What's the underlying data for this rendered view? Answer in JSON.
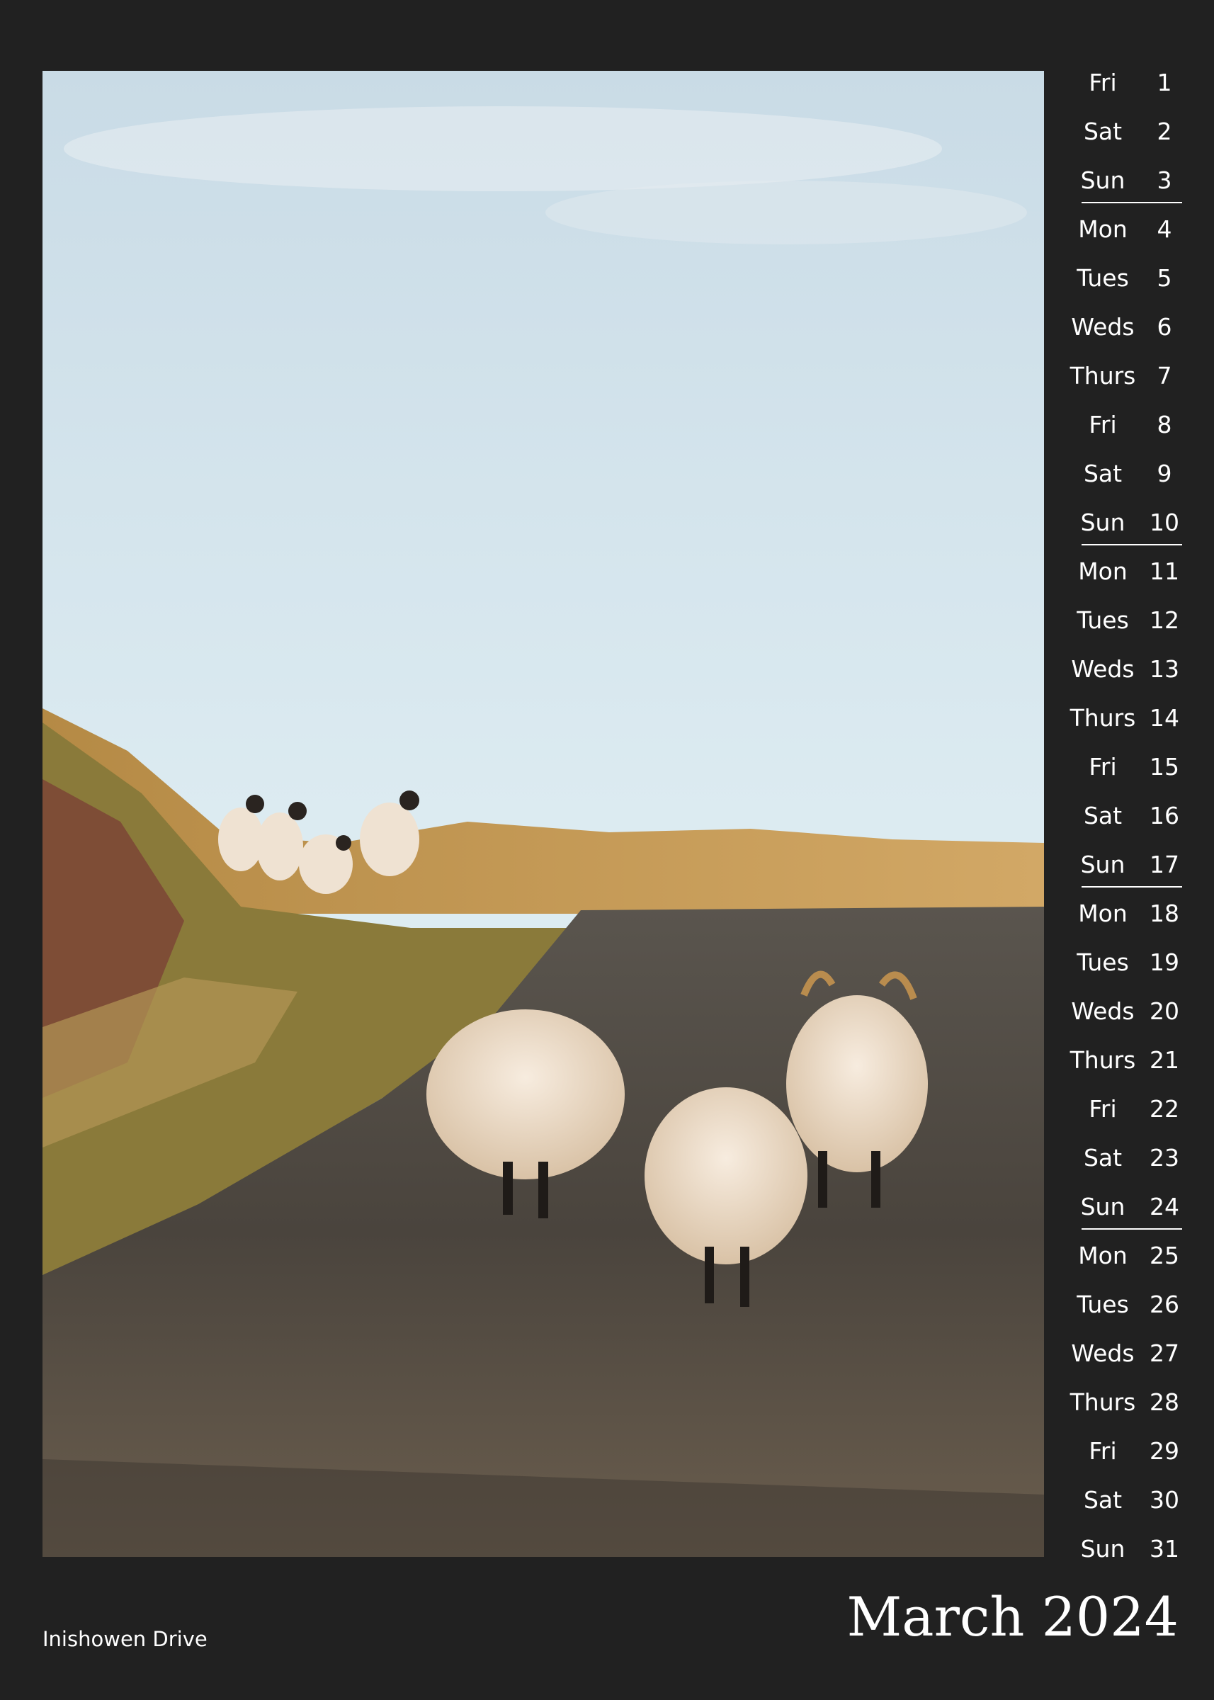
{
  "calendar": {
    "month_title": "March 2024",
    "location": "Inishowen Drive",
    "days": [
      {
        "name": "Fri",
        "number": "1"
      },
      {
        "name": "Sat",
        "number": "2"
      },
      {
        "name": "Sun",
        "number": "3"
      },
      {
        "name": "Mon",
        "number": "4"
      },
      {
        "name": "Tues",
        "number": "5"
      },
      {
        "name": "Weds",
        "number": "6"
      },
      {
        "name": "Thurs",
        "number": "7"
      },
      {
        "name": "Fri",
        "number": "8"
      },
      {
        "name": "Sat",
        "number": "9"
      },
      {
        "name": "Sun",
        "number": "10"
      },
      {
        "name": "Mon",
        "number": "11"
      },
      {
        "name": "Tues",
        "number": "12"
      },
      {
        "name": "Weds",
        "number": "13"
      },
      {
        "name": "Thurs",
        "number": "14"
      },
      {
        "name": "Fri",
        "number": "15"
      },
      {
        "name": "Sat",
        "number": "16"
      },
      {
        "name": "Sun",
        "number": "17"
      },
      {
        "name": "Mon",
        "number": "18"
      },
      {
        "name": "Tues",
        "number": "19"
      },
      {
        "name": "Weds",
        "number": "20"
      },
      {
        "name": "Thurs",
        "number": "21"
      },
      {
        "name": "Fri",
        "number": "22"
      },
      {
        "name": "Sat",
        "number": "23"
      },
      {
        "name": "Sun",
        "number": "24"
      },
      {
        "name": "Mon",
        "number": "25"
      },
      {
        "name": "Tues",
        "number": "26"
      },
      {
        "name": "Weds",
        "number": "27"
      },
      {
        "name": "Thurs",
        "number": "28"
      },
      {
        "name": "Fri",
        "number": "29"
      },
      {
        "name": "Sat",
        "number": "30"
      },
      {
        "name": "Sun",
        "number": "31"
      }
    ]
  },
  "colors": {
    "background": "#212121",
    "text": "#ffffff",
    "sky": "#dcebf1",
    "road": "#4b4640",
    "grass": "#c7a05c"
  }
}
